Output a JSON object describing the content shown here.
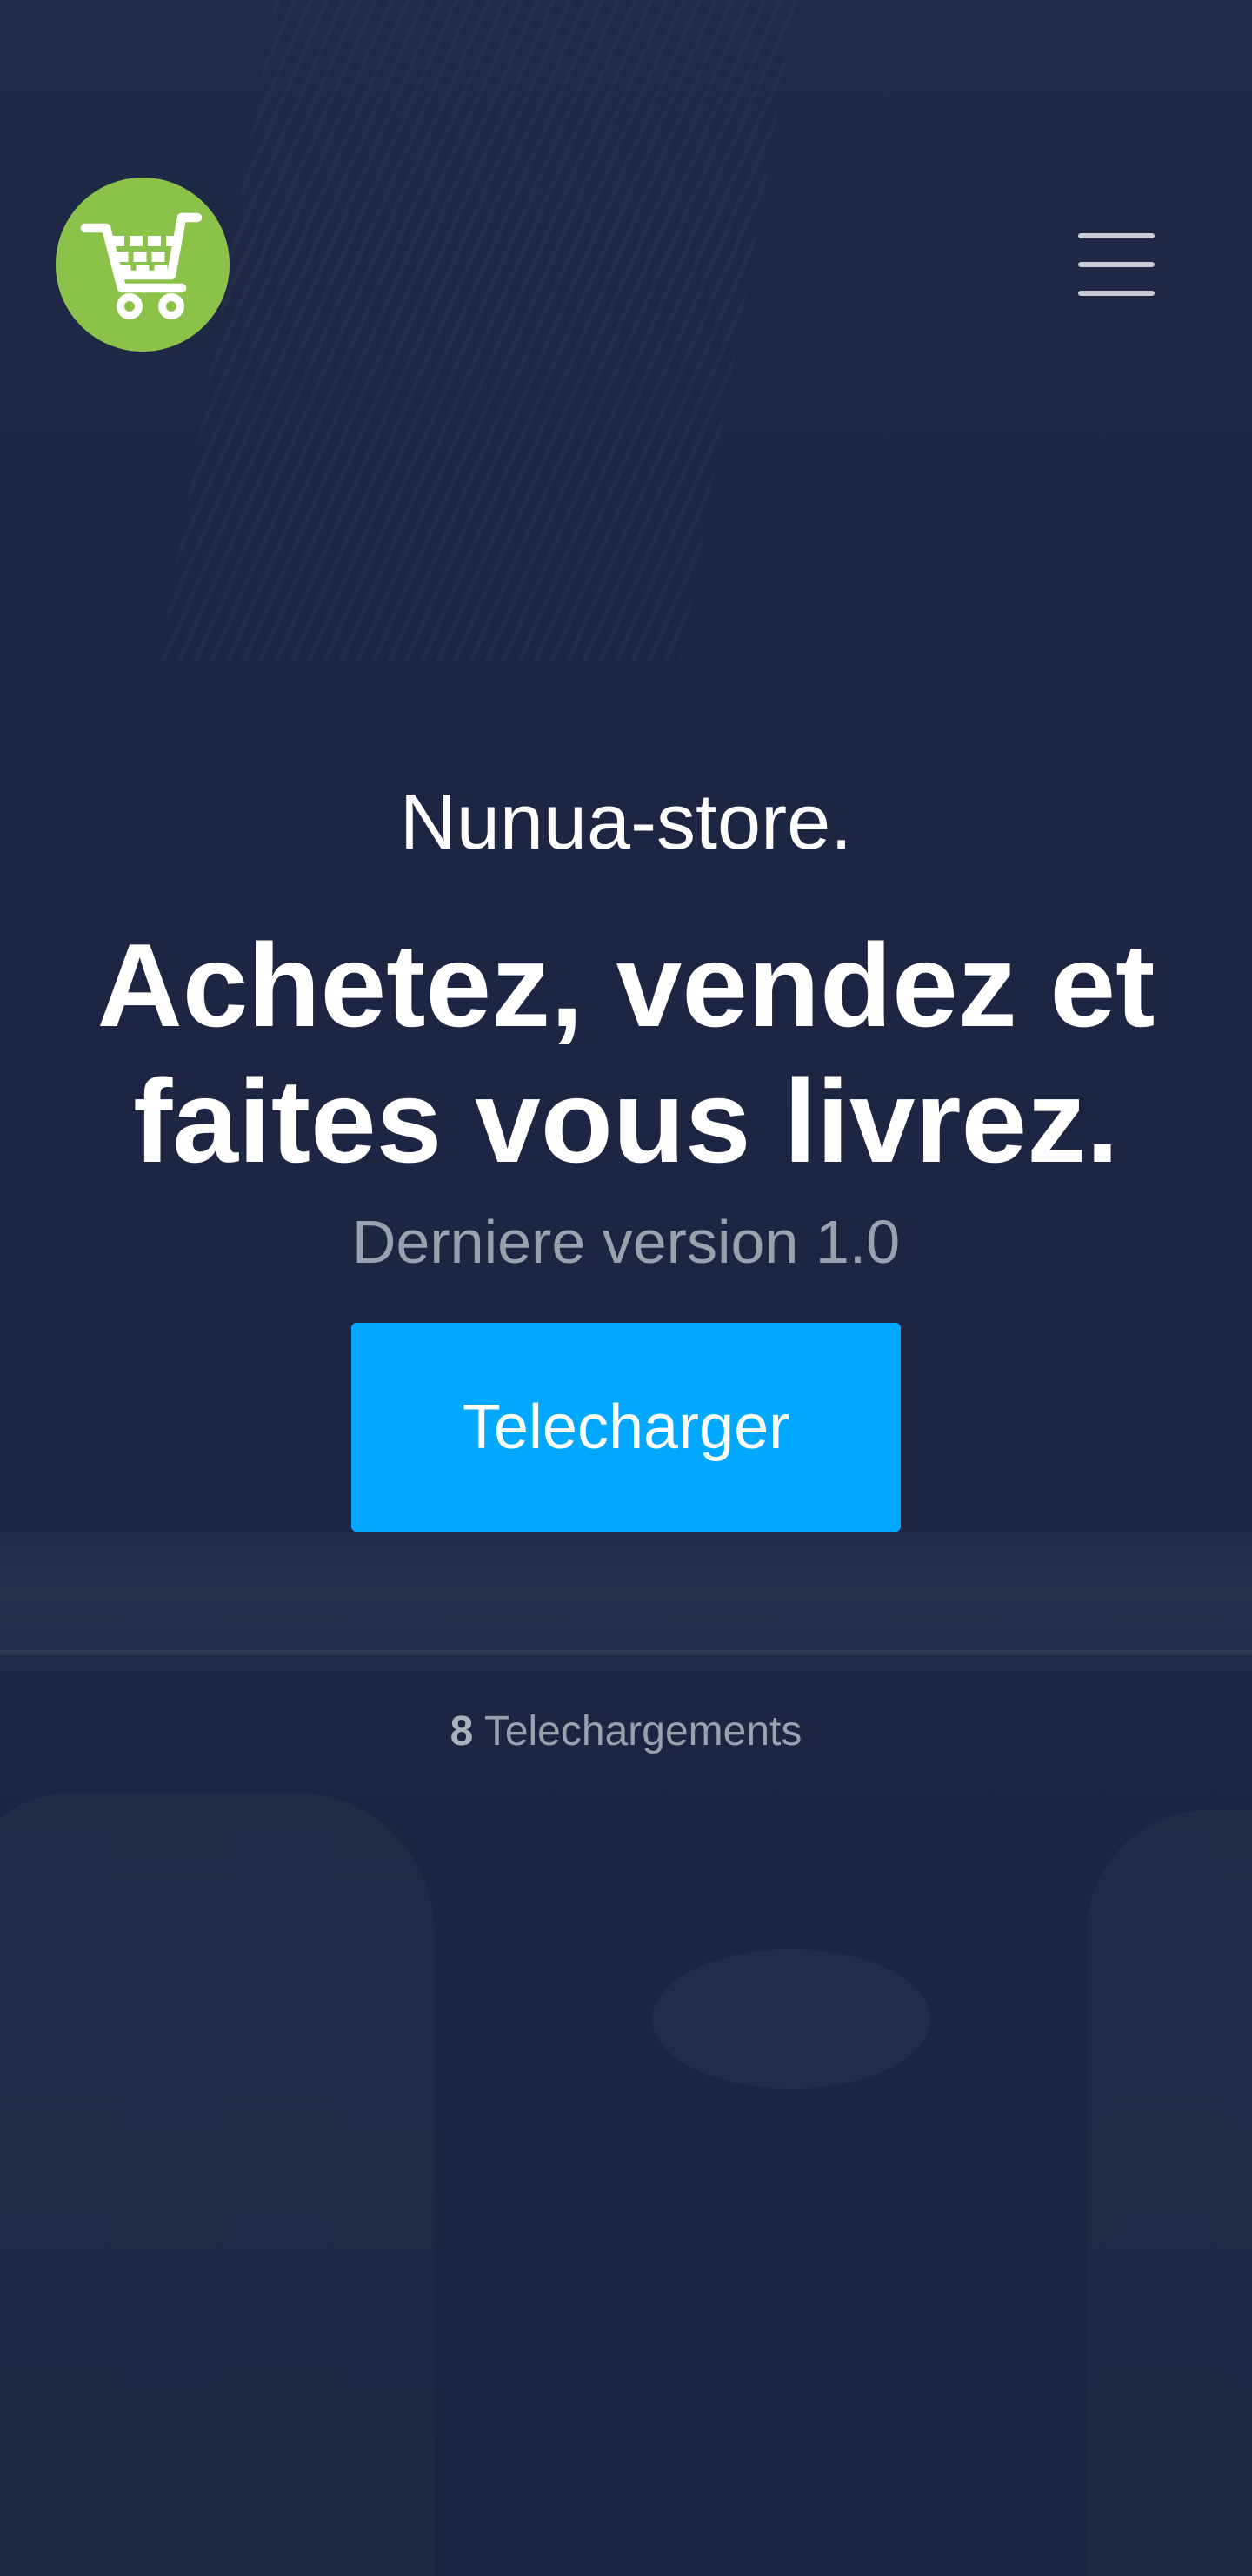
{
  "header": {
    "logo_icon": "shopping-cart-icon",
    "menu_icon": "hamburger-menu-icon"
  },
  "hero": {
    "brand": "Nunua-store.",
    "headline": "Achetez, vendez et faites vous livrez.",
    "version": "Derniere version 1.0",
    "download_label": "Telecharger"
  },
  "stats": {
    "download_count": "8",
    "download_label": "Telechargements"
  },
  "colors": {
    "background": "#1c2440",
    "logo_bg": "#8bc34a",
    "button_bg": "#00a8ff",
    "muted_text": "#9aa0ad"
  }
}
